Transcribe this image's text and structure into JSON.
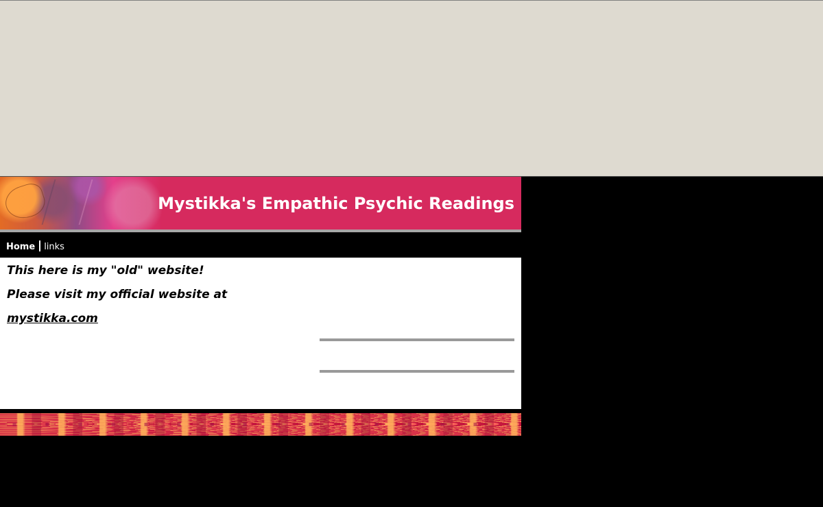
{
  "site": {
    "title": "Mystikka's Empathic Psychic Readings"
  },
  "nav": {
    "items": [
      {
        "label": "Home",
        "active": true
      },
      {
        "label": "links",
        "active": false
      }
    ]
  },
  "content": {
    "intro": "This here is my \"old\" website!",
    "visit_text": "Please visit my official website at",
    "official_link": "mystikka.com"
  },
  "colors": {
    "page_background": "#000000",
    "top_area": "#dedad0",
    "banner": "#d62a5e",
    "divider": "#999999",
    "text": "#000000",
    "nav_text": "#ffffff"
  }
}
